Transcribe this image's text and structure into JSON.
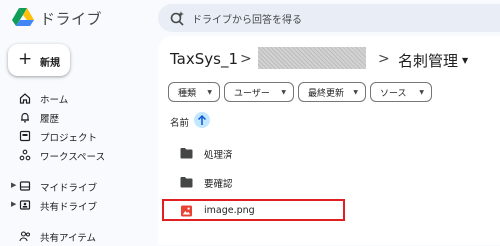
{
  "app": {
    "title": "ドライブ"
  },
  "search": {
    "placeholder": "ドライブから回答を得る"
  },
  "new_button": {
    "label": "新規"
  },
  "sidebar": {
    "items": [
      {
        "label": "ホーム",
        "icon": "home-icon"
      },
      {
        "label": "履歴",
        "icon": "bell-icon"
      },
      {
        "label": "プロジェクト",
        "icon": "project-icon"
      },
      {
        "label": "ワークスペース",
        "icon": "workspace-icon"
      },
      {
        "label": "マイドライブ",
        "icon": "drive-icon"
      },
      {
        "label": "共有ドライブ",
        "icon": "shared-drive-icon"
      },
      {
        "label": "共有アイテム",
        "icon": "people-icon"
      }
    ]
  },
  "breadcrumb": {
    "root": "TaxSys_1",
    "separator": ">",
    "current": "名刺管理"
  },
  "filters": [
    {
      "label": "種類"
    },
    {
      "label": "ユーザー"
    },
    {
      "label": "最終更新"
    },
    {
      "label": "ソース"
    }
  ],
  "table": {
    "name_header": "名前",
    "rows": [
      {
        "name": "処理済",
        "type": "folder"
      },
      {
        "name": "要確認",
        "type": "folder"
      },
      {
        "name": "image.png",
        "type": "image"
      }
    ]
  },
  "colors": {
    "accent": "#0b57d0",
    "sort_bg": "#c2e7ff",
    "highlight": "#e02020",
    "image_icon": "#ea4335"
  }
}
